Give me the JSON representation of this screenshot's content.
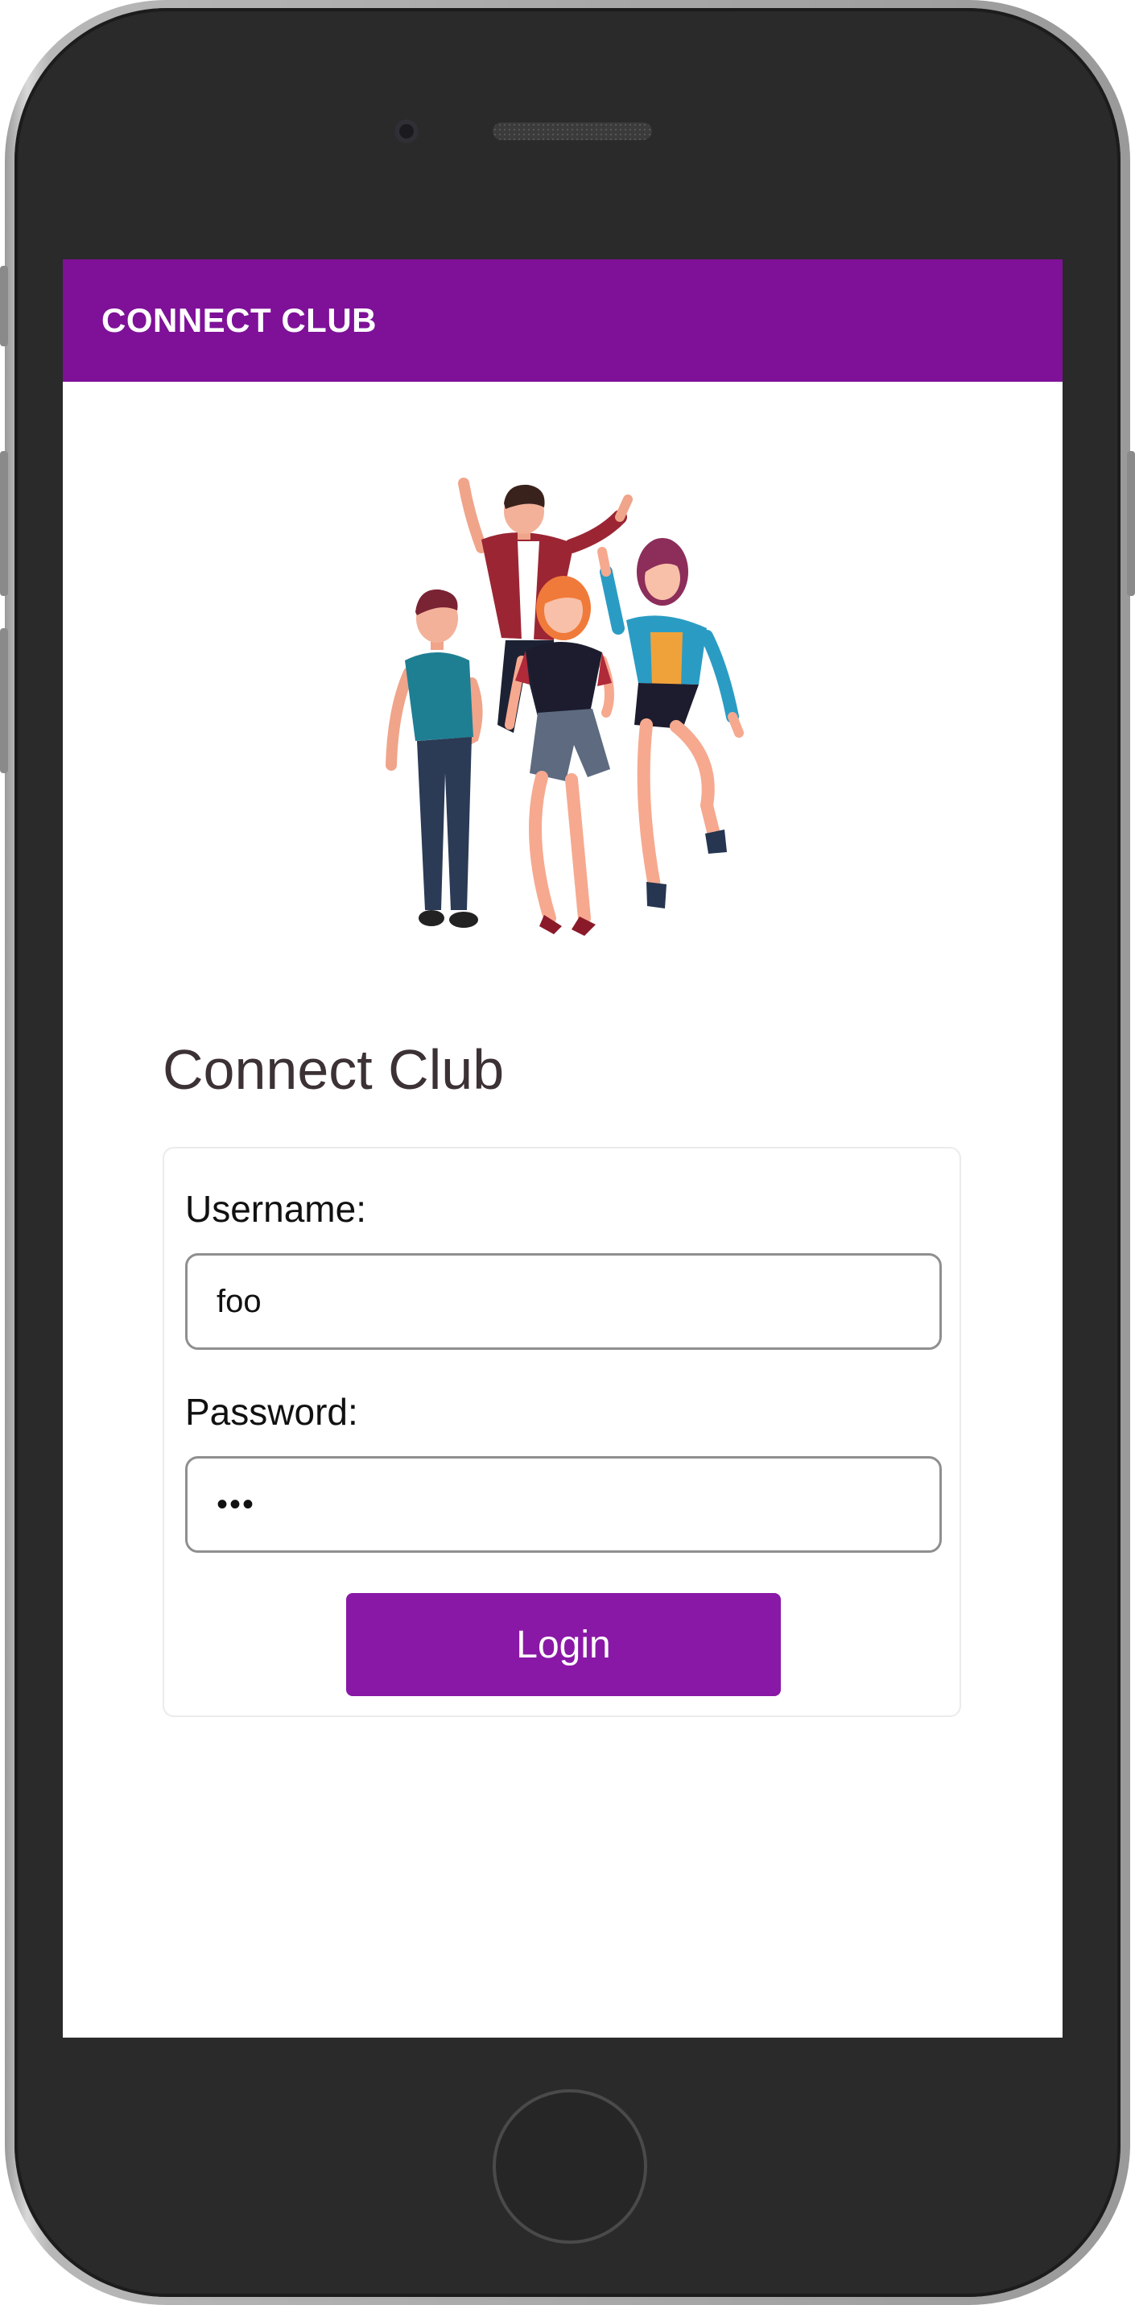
{
  "app_bar": {
    "title": "CONNECT CLUB"
  },
  "hero": {
    "image": "group-of-friends-illustration"
  },
  "page": {
    "title": "Connect Club"
  },
  "form": {
    "username_label": "Username:",
    "username_value": "foo",
    "password_label": "Password:",
    "password_value": "•••",
    "login_label": "Login"
  },
  "colors": {
    "brand_purple": "#7e1198",
    "button_purple": "#8a18a6",
    "title_text": "#3c3236"
  }
}
